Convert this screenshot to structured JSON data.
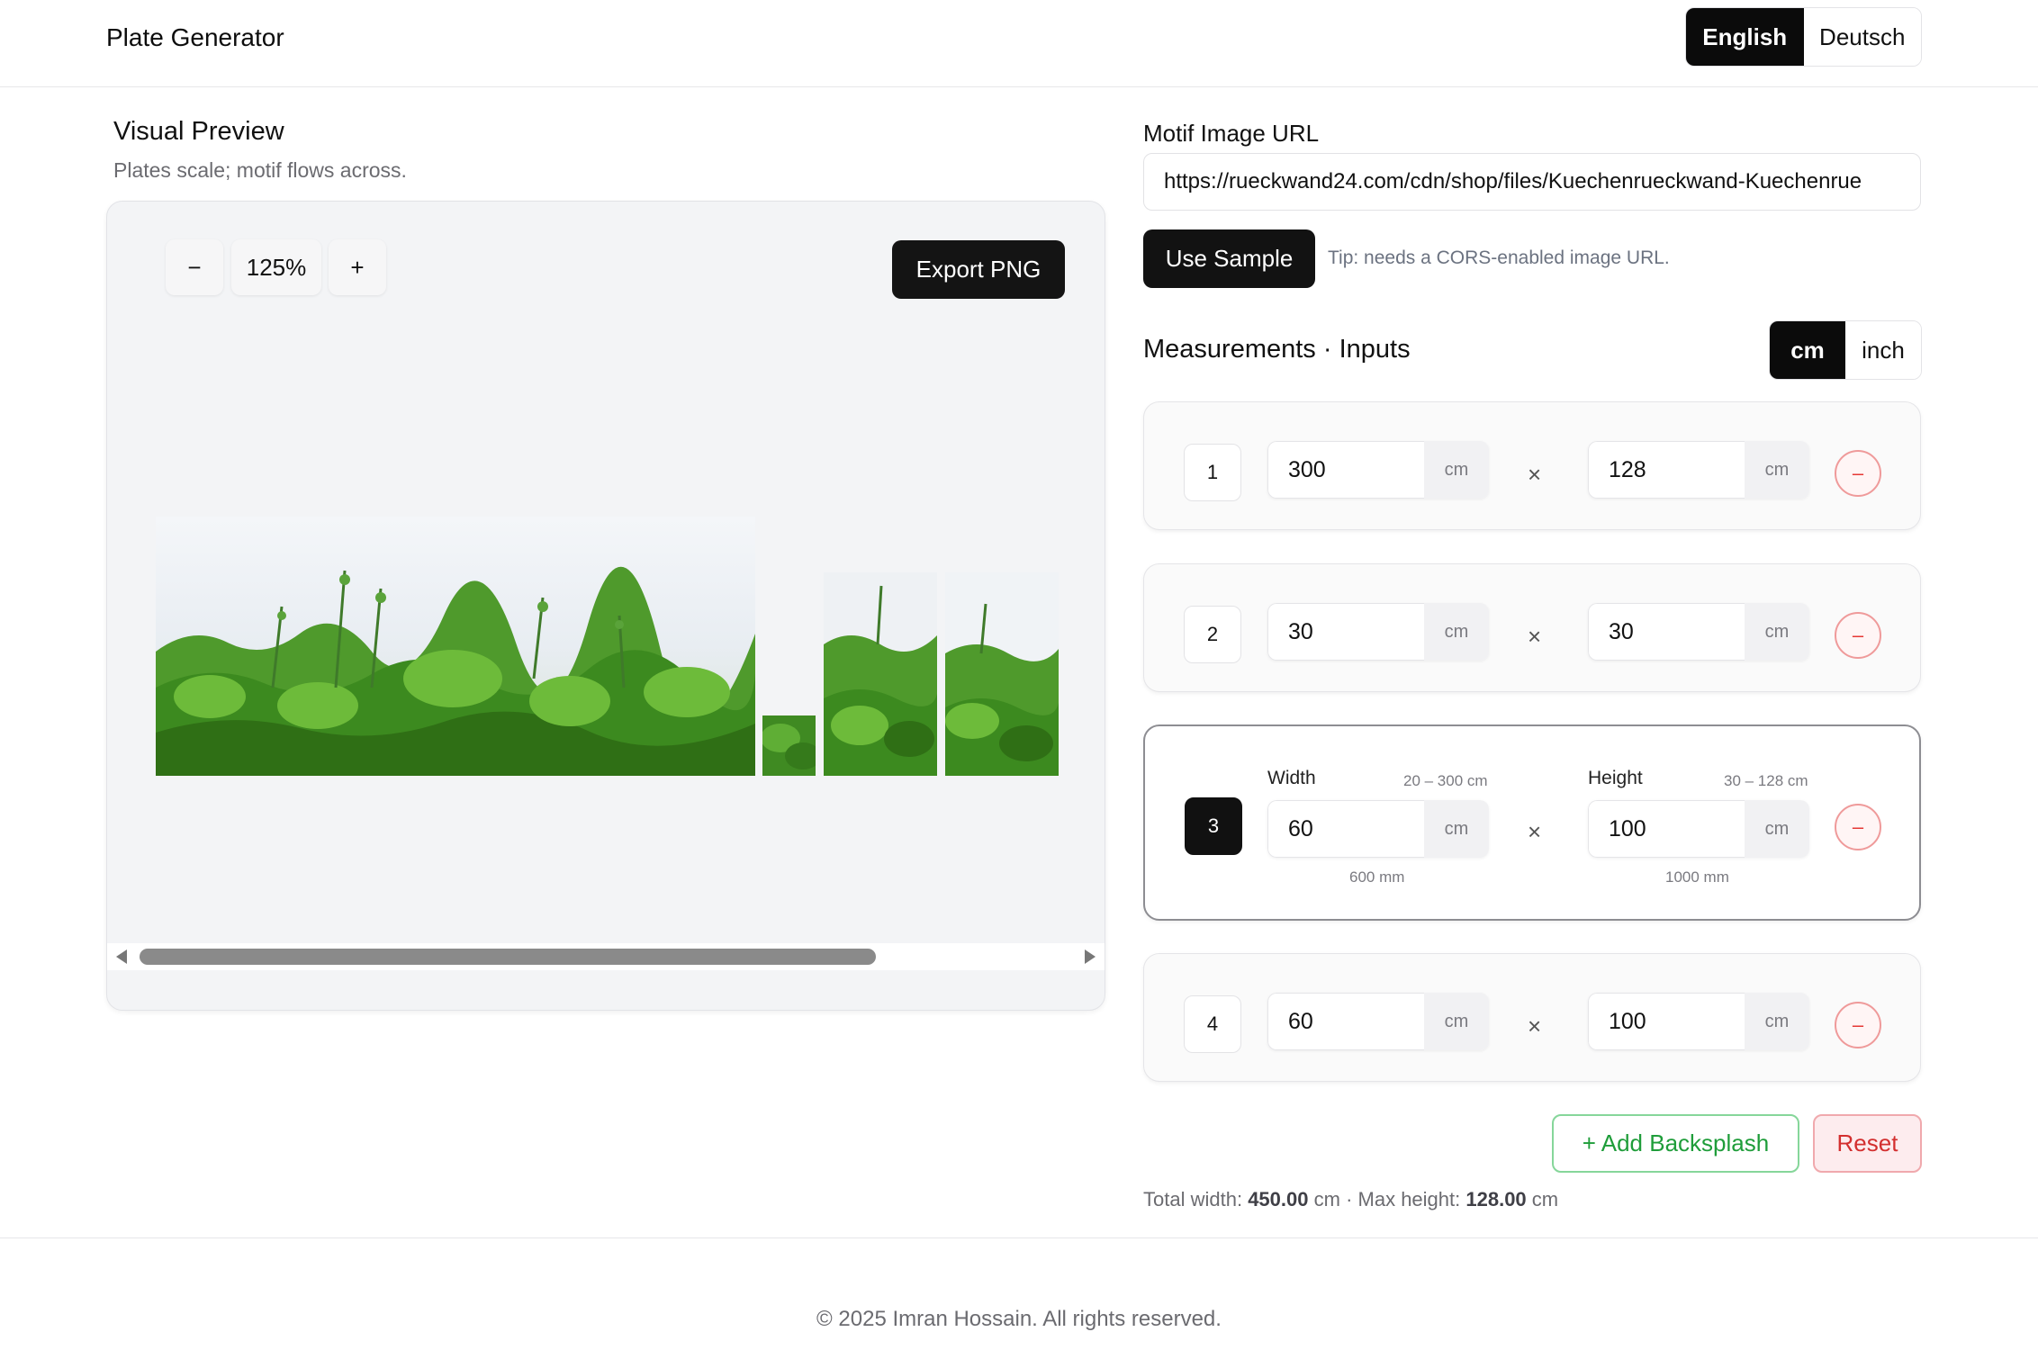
{
  "header": {
    "brand": "Plate Generator",
    "languages": [
      "English",
      "Deutsch"
    ],
    "active_language": "English"
  },
  "preview": {
    "title": "Visual Preview",
    "subtitle": "Plates scale; motif flows across.",
    "zoom_out": "−",
    "zoom_level": "125%",
    "zoom_in": "+",
    "export_label": "Export PNG"
  },
  "motif": {
    "label": "Motif Image URL",
    "url": "https://rueckwand24.com/cdn/shop/files/Kuechenrueckwand-Kuechenrue",
    "use_sample": "Use Sample",
    "tip": "Tip: needs a CORS-enabled image URL."
  },
  "measurements": {
    "title": "Measurements · Inputs",
    "units": [
      "cm",
      "inch"
    ],
    "active_unit": "cm",
    "times": "×",
    "remove": "–",
    "unit_label": "cm",
    "rows": [
      {
        "index": "1",
        "width": "300",
        "height": "128"
      },
      {
        "index": "2",
        "width": "30",
        "height": "30"
      },
      {
        "index": "3",
        "width": "60",
        "height": "100",
        "width_label": "Width",
        "width_range": "20 – 300 cm",
        "height_label": "Height",
        "height_range": "30 – 128 cm",
        "width_mm": "600 mm",
        "height_mm": "1000 mm"
      },
      {
        "index": "4",
        "width": "60",
        "height": "100"
      }
    ]
  },
  "actions": {
    "add": "+  Add Backsplash",
    "reset": "Reset"
  },
  "summary": {
    "total_label": "Total width:",
    "total_value": "450.00",
    "unit": "cm",
    "sep": "·",
    "max_label": "Max height:",
    "max_value": "128.00"
  },
  "footer": {
    "text": "© 2025 Imran Hossain. All rights reserved."
  },
  "colors": {
    "dark": "#111111",
    "green": "#1f9d3a",
    "red": "#d32f2f",
    "preview_bg": "#f3f4f6"
  }
}
